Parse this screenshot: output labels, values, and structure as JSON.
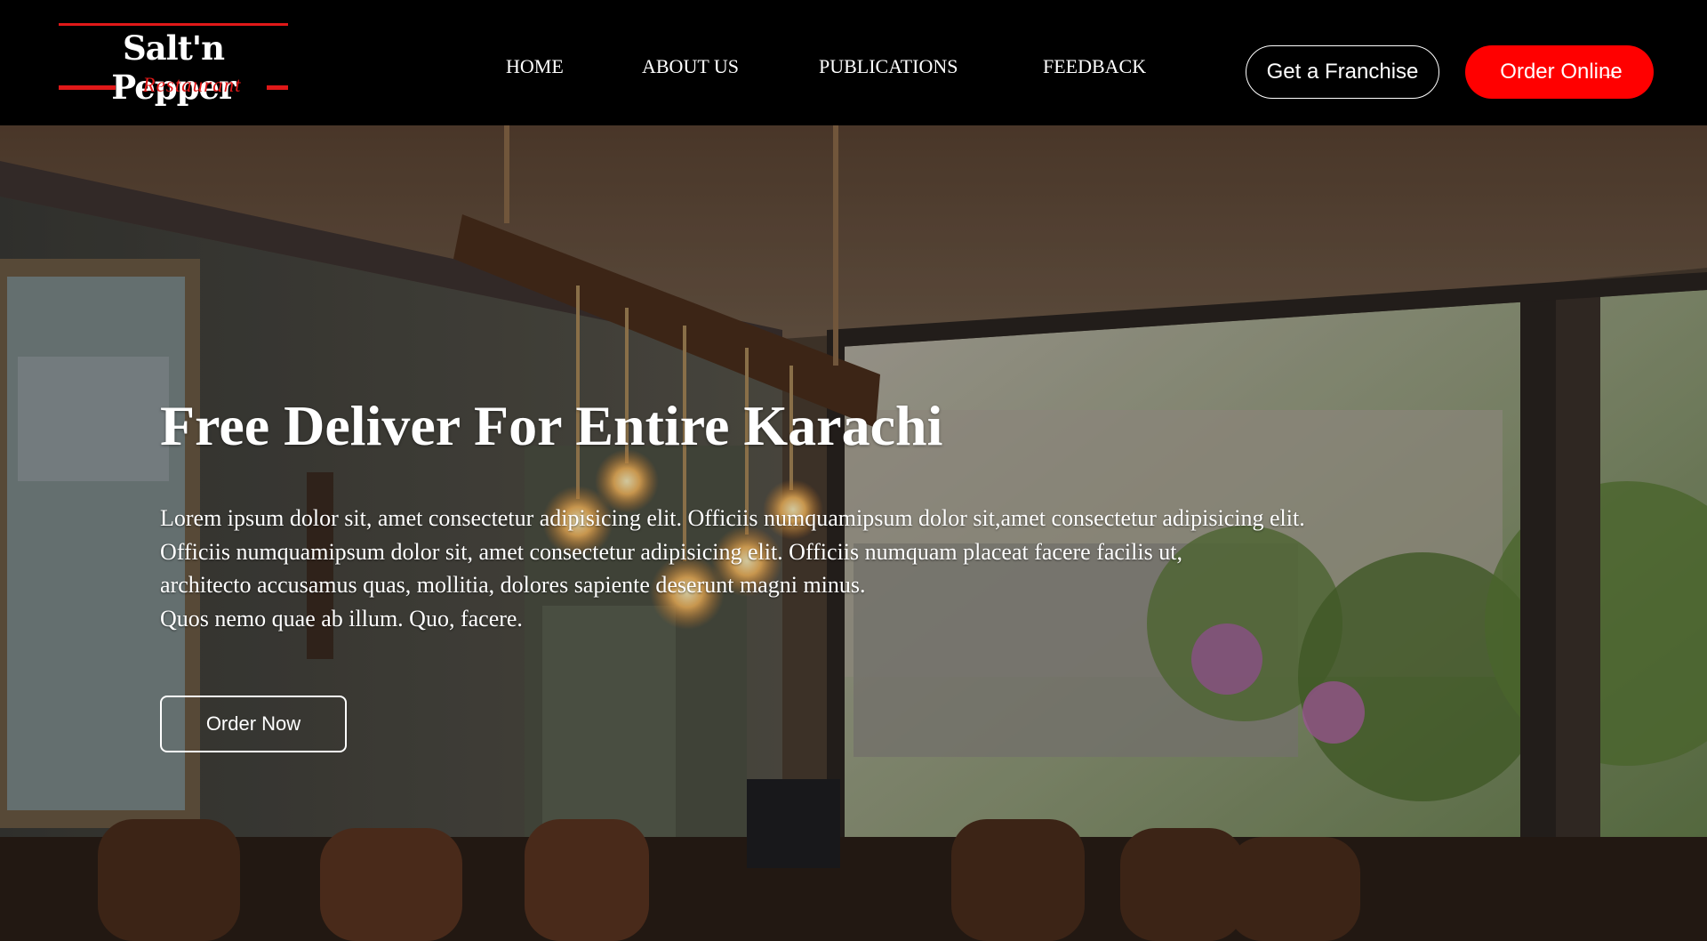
{
  "brand": {
    "name": "Salt'n Pepper",
    "subtitle": "Restaurant",
    "accent_color": "#e01818"
  },
  "nav": {
    "items": [
      {
        "label": "HOME"
      },
      {
        "label": "ABOUT US"
      },
      {
        "label": "PUBLICATIONS"
      },
      {
        "label": "FEEDBACK"
      }
    ]
  },
  "header_actions": {
    "franchise_label": "Get a Franchise",
    "order_online_label": "Order Online",
    "order_online_icon": "arrow-right-icon",
    "order_online_color": "#ff0000"
  },
  "hero": {
    "title": "Free Deliver For Entire Karachi",
    "lines": [
      "Lorem ipsum dolor sit, amet consectetur adipisicing elit. Officiis numquamipsum dolor sit,amet consectetur adipisicing elit.",
      "Officiis numquamipsum dolor sit, amet consectetur adipisicing elit. Officiis numquam placeat facere facilis ut,",
      "architecto accusamus quas, mollitia, dolores sapiente deserunt magni minus.",
      "Quos nemo quae ab illum. Quo, facere."
    ],
    "cta_label": "Order Now"
  }
}
